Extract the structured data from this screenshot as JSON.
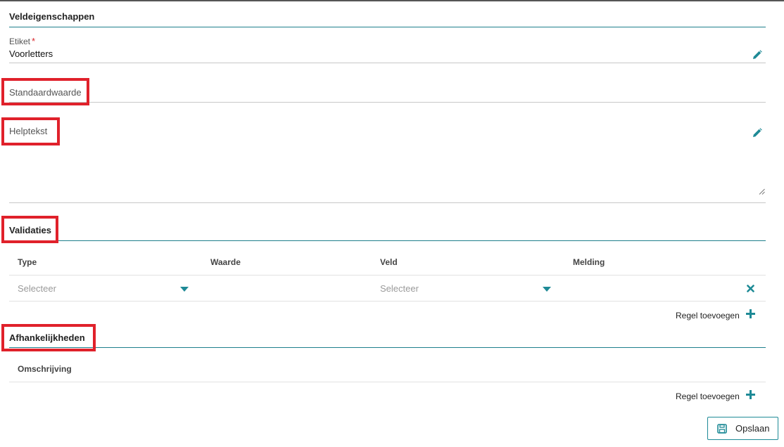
{
  "field_properties": {
    "title": "Veldeigenschappen",
    "label_field": {
      "label": "Etiket",
      "required_mark": "*",
      "value": "Voorletters",
      "edit_icon": "pencil-icon"
    },
    "default_value_field": {
      "placeholder": "Standaardwaarde"
    },
    "help_text_field": {
      "placeholder": "Helptekst",
      "edit_icon": "pencil-icon"
    }
  },
  "validations": {
    "title": "Validaties",
    "columns": [
      "Type",
      "Waarde",
      "Veld",
      "Melding"
    ],
    "row": {
      "type_placeholder": "Selecteer",
      "field_placeholder": "Selecteer",
      "remove_icon": "close-icon"
    },
    "add_rule_label": "Regel toevoegen",
    "add_icon": "plus-icon"
  },
  "dependencies": {
    "title": "Afhankelijkheden",
    "columns": [
      "Omschrijving"
    ],
    "add_rule_label": "Regel toevoegen",
    "add_icon": "plus-icon"
  },
  "footer": {
    "save_label": "Opslaan",
    "save_icon": "floppy-disk-icon"
  },
  "colors": {
    "accent": "#1e8a96",
    "highlight": "#e0212b",
    "required": "#d9262b"
  }
}
